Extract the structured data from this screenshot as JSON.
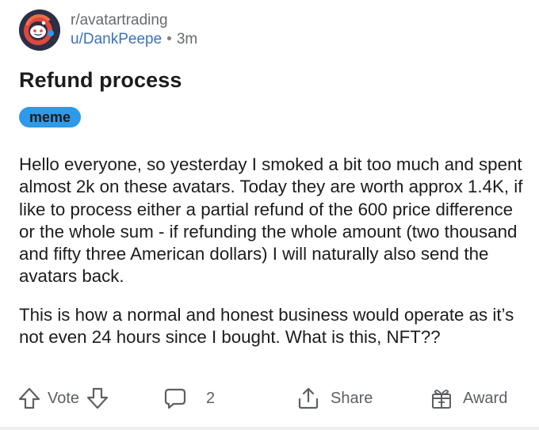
{
  "post": {
    "subreddit": "r/avatartrading",
    "author": "u/DankPeepe",
    "separator": "•",
    "age": "3m",
    "title": "Refund process",
    "flair": "meme",
    "paragraphs": [
      "Hello everyone, so yesterday I smoked a bit too much and spent almost 2k on these avatars. Today they are worth approx 1.4K, if like to process either a partial refund of the 600 price difference or the whole sum - if refunding the whole amount (two thousand and fifty three American dollars) I will naturally also send the avatars back.",
      "This is how a normal and honest business would operate as it’s not even 24 hours since I bought. What is this, NFT??"
    ]
  },
  "actions": {
    "vote_label": "Vote",
    "comment_count": "2",
    "share_label": "Share",
    "award_label": "Award"
  },
  "icons": {
    "avatar": "subreddit-avatar-icon",
    "upvote": "upvote-arrow-icon",
    "downvote": "downvote-arrow-icon",
    "comment": "comment-bubble-icon",
    "share": "share-upload-icon",
    "award": "gift-award-icon"
  },
  "colors": {
    "author_link": "#3a72b8",
    "flair_background": "#2e9ae9",
    "muted_text": "#666a6e",
    "avatar_background": "#2c2f45"
  }
}
